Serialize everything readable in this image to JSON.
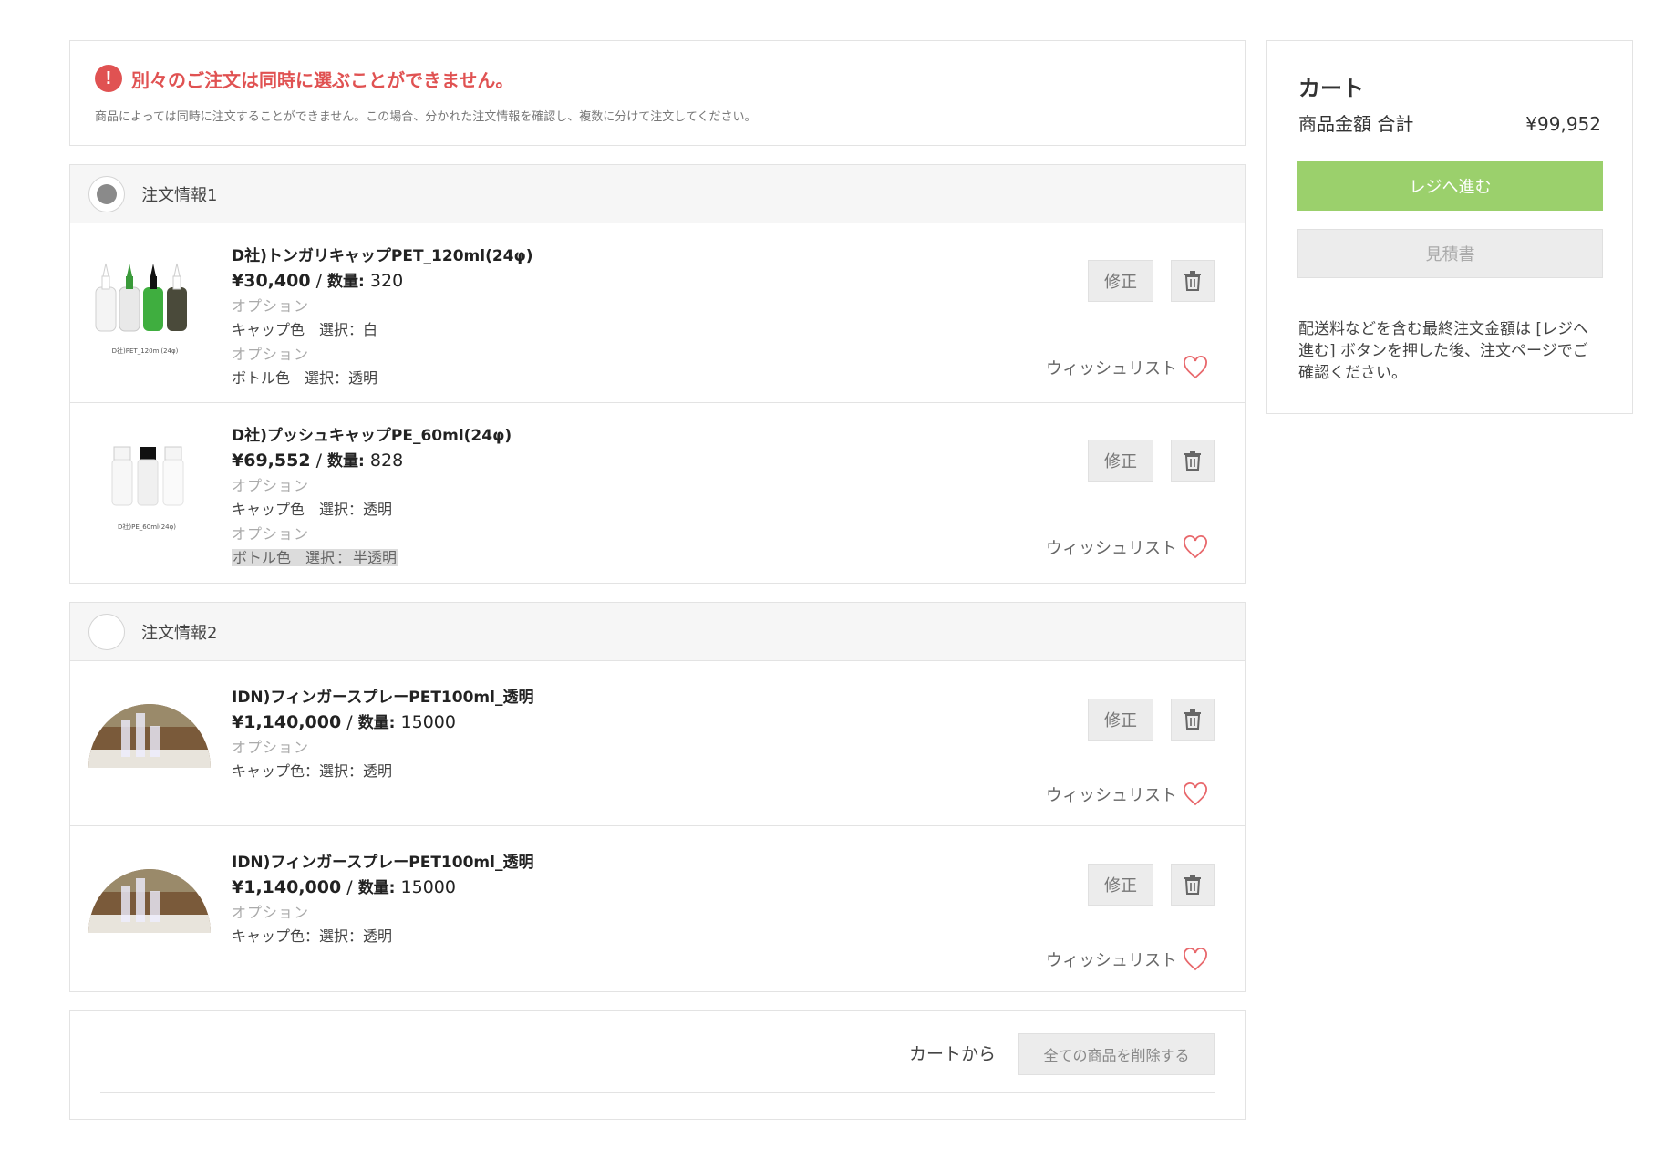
{
  "notice": {
    "icon": "!",
    "title": "別々のご注文は同時に選ぶことができません。",
    "text": "商品によっては同時に注文することができません。この場合、分かれた注文情報を確認し、複数に分けて注文してください。"
  },
  "labels": {
    "edit": "修正",
    "wishlist": "ウィッシュリスト",
    "option": "オプション",
    "sep": " / ",
    "quantity": "数量:"
  },
  "groups": [
    {
      "title": "注文情報1",
      "selected": true,
      "items": [
        {
          "name": "D社)トンガリキャップPET_120ml(24φ)",
          "price": "¥30,400",
          "quantity": "320",
          "thumb_caption": "D社)PET_120ml(24φ)",
          "options": [
            {
              "label": "オプション",
              "value": "キャップ色　選択：白"
            },
            {
              "label": "オプション",
              "value": "ボトル色　選択：透明"
            }
          ]
        },
        {
          "name": "D社)プッシュキャップPE_60ml(24φ)",
          "price": "¥69,552",
          "quantity": "828",
          "thumb_caption": "D社)PE_60ml(24φ)",
          "options": [
            {
              "label": "オプション",
              "value": "キャップ色　選択：透明"
            },
            {
              "label": "オプション",
              "value_a": "ボトル色　選択",
              "value_sep": "：",
              "value_b": "半透明"
            }
          ]
        }
      ]
    },
    {
      "title": "注文情報2",
      "selected": false,
      "items": [
        {
          "name": "IDN)フィンガースプレーPET100ml_透明",
          "price": "¥1,140,000",
          "quantity": "15000",
          "options": [
            {
              "label": "オプション",
              "value": "キャップ色：選択：透明"
            }
          ]
        },
        {
          "name": "IDN)フィンガースプレーPET100ml_透明",
          "price": "¥1,140,000",
          "quantity": "15000",
          "options": [
            {
              "label": "オプション",
              "value": "キャップ色：選択：透明"
            }
          ]
        }
      ]
    }
  ],
  "footer": {
    "label": "カートから",
    "delete_all": "全ての商品を削除する"
  },
  "cart": {
    "title": "カート",
    "subtotal_label": "商品金額 合計",
    "subtotal": "¥99,952",
    "checkout": "レジへ進む",
    "quote": "見積書",
    "note": "配送料などを含む最終注文金額は [レジへ進む] ボタンを押した後、注文ページでご確認ください。"
  },
  "colors": {
    "alert": "#e05252",
    "checkout": "#9bd06c",
    "heart": "#e8676b"
  },
  "icons": {
    "warning": "warning-icon",
    "trash": "trash-icon",
    "heart": "heart-icon",
    "radio": "radio-icon"
  }
}
